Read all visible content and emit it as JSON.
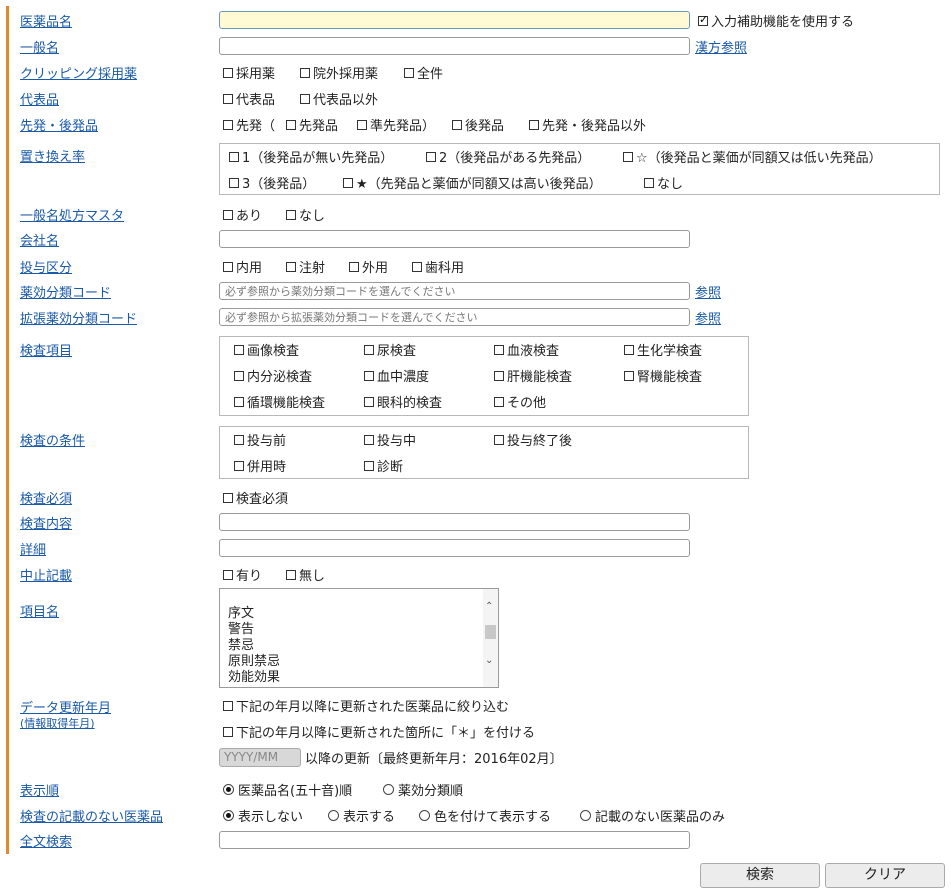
{
  "labels": {
    "drug_name": "医薬品名",
    "generic_name": "一般名",
    "clipping": "クリッピング採用薬",
    "representative": "代表品",
    "brand_generic": "先発・後発品",
    "replacement_rate": "置き換え率",
    "generic_rx_master": "一般名処方マスタ",
    "company": "会社名",
    "admin_category": "投与区分",
    "efficacy_code": "薬効分類コード",
    "ext_efficacy_code": "拡張薬効分類コード",
    "test_items": "検査項目",
    "test_conditions": "検査の条件",
    "test_required": "検査必須",
    "test_content": "検査内容",
    "details": "詳細",
    "discontinued": "中止記載",
    "item_name": "項目名",
    "data_update": "データ更新年月",
    "data_update_sub": "(情報取得年月)",
    "sort_order": "表示順",
    "no_test_drugs": "検査の記載のない医薬品",
    "fulltext": "全文検索"
  },
  "input_assist": "入力補助機能を使用する",
  "kampo_ref": "漢方参照",
  "ref_link": "参照",
  "clipping_options": [
    "採用薬",
    "院外採用薬",
    "全件"
  ],
  "representative_options": [
    "代表品",
    "代表品以外"
  ],
  "brand_generic_options": [
    "先発（",
    "先発品",
    "準先発品）",
    "後発品",
    "先発・後発品以外"
  ],
  "replacement_options": [
    "1（後発品が無い先発品）",
    "2（後発品がある先発品）",
    "☆（後発品と薬価が同額又は低い先発品）",
    "3（後発品）",
    "★（先発品と薬価が同額又は高い後発品）",
    "なし"
  ],
  "generic_rx_options": [
    "あり",
    "なし"
  ],
  "admin_options": [
    "内用",
    "注射",
    "外用",
    "歯科用"
  ],
  "efficacy_placeholder": "必ず参照から薬効分類コードを選んでください",
  "ext_efficacy_placeholder": "必ず参照から拡張薬効分類コードを選んでください",
  "test_item_options": [
    "画像検査",
    "尿検査",
    "血液検査",
    "生化学検査",
    "内分泌検査",
    "血中濃度",
    "肝機能検査",
    "腎機能検査",
    "循環機能検査",
    "眼科的検査",
    "その他"
  ],
  "test_condition_options": [
    "投与前",
    "投与中",
    "投与終了後",
    "併用時",
    "診断"
  ],
  "test_required_option": "検査必須",
  "discontinued_options": [
    "有り",
    "無し"
  ],
  "item_name_list": [
    "",
    "序文",
    "警告",
    "禁忌",
    "原則禁忌",
    "効能効果"
  ],
  "update_filter_option": "下記の年月以降に更新された医薬品に絞り込む",
  "update_mark_option": "下記の年月以降に更新された箇所に「＊」を付ける",
  "date_placeholder": "YYYY/MM",
  "update_note": "以降の更新〔最終更新年月：2016年02月〕",
  "sort_options": [
    "医薬品名(五十音)順",
    "薬効分類順"
  ],
  "no_test_options": [
    "表示しない",
    "表示する",
    "色を付けて表示する",
    "記載のない医薬品のみ"
  ],
  "buttons": {
    "search": "検索",
    "clear": "クリア"
  },
  "colors": {
    "accent_bar": "#e4882c",
    "label_link": "#1a5aa8",
    "highlight_input": "#fff9d4"
  }
}
